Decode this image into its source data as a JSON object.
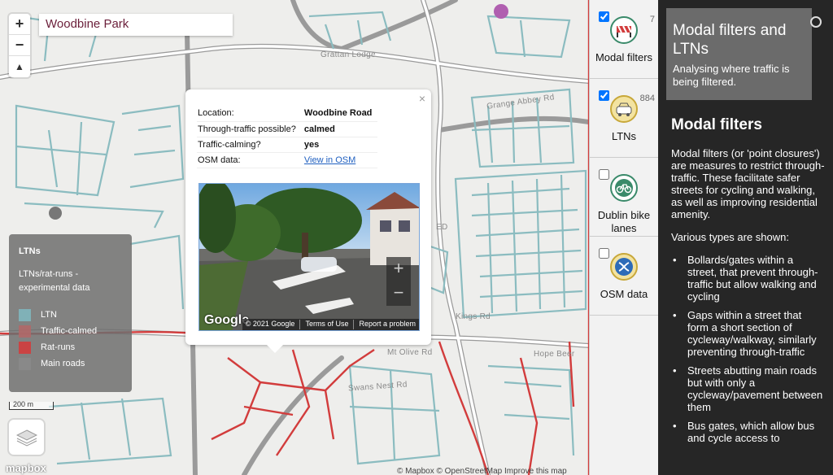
{
  "search": {
    "value": "Woodbine Park"
  },
  "zoom": {
    "in": "+",
    "out": "−",
    "compass": "▲"
  },
  "map_labels": {
    "grattan_lodge": "Grattan Lodge",
    "grange_abbey": "Grange Abbey Rd",
    "hope_beer": "Hope Beer",
    "kings_rd": "Kings Rd",
    "mt_olive": "Mt Olive Rd",
    "swans_nest": "Swans Nest Rd",
    "greendale": "ED"
  },
  "popup": {
    "close": "×",
    "rows": [
      {
        "key": "Location:",
        "value": "Woodbine Road"
      },
      {
        "key": "Through-traffic possible?",
        "value": "calmed"
      },
      {
        "key": "Traffic-calming?",
        "value": "yes"
      }
    ],
    "osm_key": "OSM data:",
    "osm_link": "View in OSM",
    "streetview": {
      "google": "Google",
      "copyright": "© 2021 Google",
      "terms": "Terms of Use",
      "report": "Report a problem"
    }
  },
  "legend": {
    "title": "LTNs",
    "subtitle": "LTNs/rat-runs - experimental data",
    "items": [
      {
        "label": "LTN",
        "color": "#7fb6bc"
      },
      {
        "label": "Traffic-calmed",
        "color": "#b06868"
      },
      {
        "label": "Rat-runs",
        "color": "#d23c3c"
      },
      {
        "label": "Main roads",
        "color": "#8a8a8a"
      }
    ]
  },
  "scale": "200 m",
  "mapbox": "mapbox",
  "attribution": "© Mapbox © OpenStreetMap Improve this map",
  "layers": [
    {
      "label": "Modal filters",
      "count": "7",
      "checked": true,
      "icon": "barrier-icon"
    },
    {
      "label": "LTNs",
      "count": "884",
      "checked": true,
      "icon": "car-icon"
    },
    {
      "label": "Dublin bike lanes",
      "count": "",
      "checked": false,
      "icon": "bike-icon"
    },
    {
      "label": "OSM data",
      "count": "",
      "checked": false,
      "icon": "osm-icon"
    }
  ],
  "panel": {
    "title": "Modal filters and LTNs",
    "subtitle": "Analysing where traffic is being filtered.",
    "heading": "Modal filters",
    "intro": "Modal filters (or 'point closures') are measures to restrict through-traffic. These facilitate safer streets for cycling and walking, as well as improving residential amenity.",
    "types_intro": "Various types are shown:",
    "types": [
      "Bollards/gates within a street, that prevent through-traffic but allow walking and cycling",
      "Gaps within a street that form a short section of cycleway/walkway, similarly preventing through-traffic",
      "Streets abutting main roads but with only a cycleway/pavement between them",
      "Bus gates, which allow bus and cycle access to"
    ]
  }
}
